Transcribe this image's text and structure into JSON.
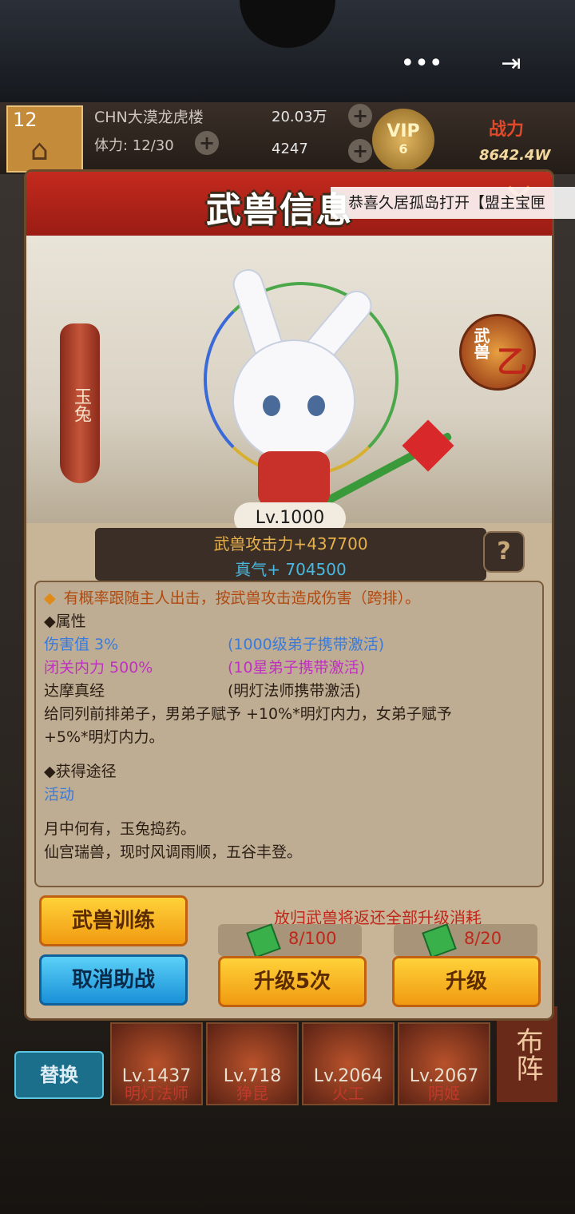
{
  "topbar": {
    "more_icon": "more-dots-icon",
    "exit_icon": "exit-icon"
  },
  "hud": {
    "level": "12",
    "player_name": "CHN大漠龙虎楼",
    "stamina": "体力: 12/30",
    "silver": "20.03万",
    "gold": "4247",
    "vip_label": "VIP",
    "vip_level": "6",
    "power_label": "战力",
    "power_value": "8642.4W"
  },
  "announcement": "恭喜久居孤岛打开【盟主宝匣",
  "modal": {
    "title": "武兽信息",
    "pet_name": "玉兔",
    "grade_prefix": "武兽",
    "grade": "乙",
    "level": "Lv.1000",
    "attack": "武兽攻击力+437700",
    "qi": "真气+ 704500",
    "effect": "有概率跟随主人出击，按武兽攻击造成伤害（跨排）。",
    "attr_title": "◆属性",
    "attributes": [
      {
        "name": "伤害值 3%",
        "cond": "(1000级弟子携带激活)",
        "color": "#3a7ad8"
      },
      {
        "name": "闭关内力 500%",
        "cond": "(10星弟子携带激活)",
        "color": "#c030c0"
      },
      {
        "name": "达摩真经",
        "cond": "(明灯法师携带激活)",
        "color": "#2a1e14"
      }
    ],
    "bonus_line1": "给同列前排弟子，男弟子赋予 +10%*明灯内力，女弟子赋予",
    "bonus_line2": "+5%*明灯内力。",
    "source_title": "◆获得途径",
    "source": "活动",
    "lore_line1": "月中何有，玉兔捣药。",
    "lore_line2": "仙宫瑞兽，现时风调雨顺，五谷丰登。",
    "train_button": "武兽训练",
    "cancel_button": "取消助战",
    "release_note": "放归武兽将返还全部升级消耗",
    "cost_5x": "8/100",
    "cost_1x": "8/20",
    "upgrade5_button": "升级5次",
    "upgrade_button": "升级"
  },
  "bottom": {
    "replace_button": "替换",
    "formation": "布阵",
    "characters": [
      {
        "level": "Lv.1437",
        "name": "明灯法师"
      },
      {
        "level": "Lv.718",
        "name": "狰昆"
      },
      {
        "level": "Lv.2064",
        "name": "火工"
      },
      {
        "level": "Lv.2067",
        "name": "阴姬"
      }
    ]
  },
  "colors": {
    "header_red": "#c42a1e",
    "accent_gold": "#f09a10",
    "accent_blue": "#1a90d8"
  }
}
